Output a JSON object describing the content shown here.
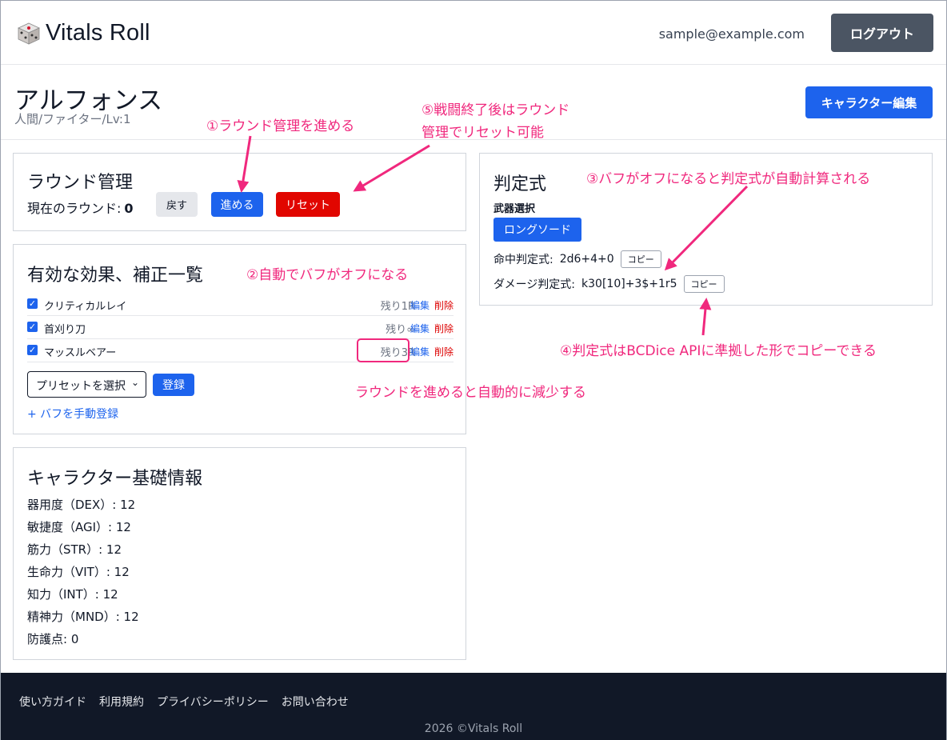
{
  "header": {
    "brand": "Vitals Roll",
    "email": "sample@example.com",
    "logout": "ログアウト"
  },
  "character": {
    "name": "アルフォンス",
    "subtitle": "人間/ファイター/Lv:1",
    "edit_button": "キャラクター編集"
  },
  "round": {
    "title": "ラウンド管理",
    "label": "現在のラウンド:",
    "value": "0",
    "back": "戻す",
    "next": "進める",
    "reset": "リセット"
  },
  "effects": {
    "title": "有効な効果、補正一覧",
    "items": [
      {
        "name": "クリティカルレイ",
        "remain": "残り1R",
        "edit": "編集",
        "delete": "削除",
        "checked": true
      },
      {
        "name": "首刈り刀",
        "remain": "残り∞",
        "edit": "編集",
        "delete": "削除",
        "checked": true
      },
      {
        "name": "マッスルベアー",
        "remain": "残り3R",
        "edit": "編集",
        "delete": "削除",
        "checked": true
      }
    ],
    "preset_placeholder": "プリセットを選択",
    "register": "登録",
    "manual": "+ バフを手動登録"
  },
  "stats": {
    "title": "キャラクター基礎情報",
    "items": [
      "器用度（DEX）: 12",
      "敏捷度（AGI）: 12",
      "筋力（STR）: 12",
      "生命力（VIT）: 12",
      "知力（INT）: 12",
      "精神力（MND）: 12",
      "防護点: 0"
    ]
  },
  "formula": {
    "title": "判定式",
    "weapon_label": "武器選択",
    "weapon": "ロングソード",
    "hit_label": "命中判定式:",
    "hit_value": "2d6+4+0",
    "damage_label": "ダメージ判定式:",
    "damage_value": "k30[10]+3$+1r5",
    "copy": "コピー"
  },
  "annotations": {
    "a1": "①ラウンド管理を進める",
    "a2": "②自動でバフがオフになる",
    "a3": "③バフがオフになると判定式が自動計算される",
    "a4": "④判定式はBCDice APIに準拠した形でコピーできる",
    "a5_line1": "⑤戦闘終了後はラウンド",
    "a5_line2": "管理でリセット可能",
    "a6": "ラウンドを進めると自動的に減少する"
  },
  "footer": {
    "links": [
      "使い方ガイド",
      "利用規約",
      "プライバシーポリシー",
      "お問い合わせ"
    ],
    "copyright": "2026 ©Vitals Roll"
  },
  "colors": {
    "primary": "#1d63ed",
    "danger": "#e10600",
    "annotation": "#f0287d",
    "footer_bg": "#111827"
  }
}
